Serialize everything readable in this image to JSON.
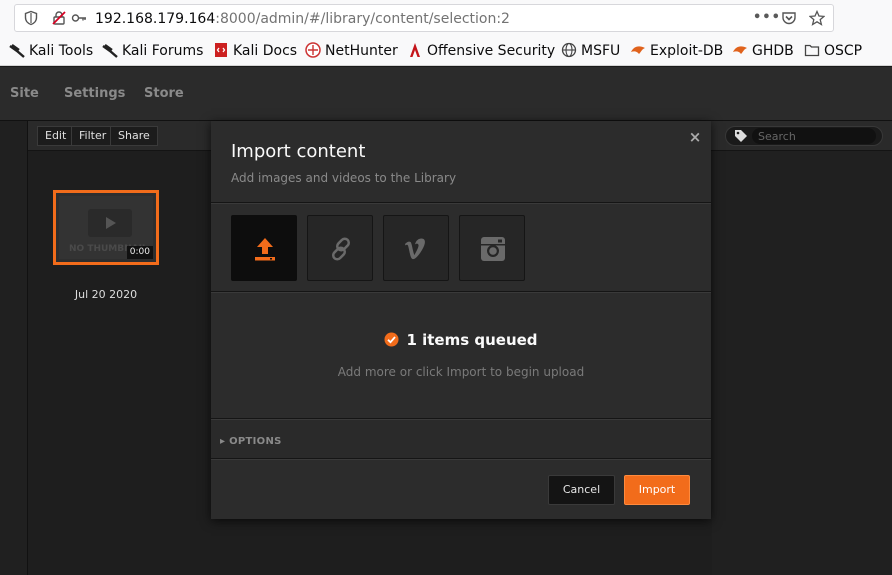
{
  "browser": {
    "url_host": "192.168.179.164",
    "url_rest": ":8000/admin/#/library/content/selection:2",
    "bookmarks": [
      {
        "label": "Kali Tools"
      },
      {
        "label": "Kali Forums"
      },
      {
        "label": "Kali Docs"
      },
      {
        "label": "NetHunter"
      },
      {
        "label": "Offensive Security"
      },
      {
        "label": "MSFU"
      },
      {
        "label": "Exploit-DB"
      },
      {
        "label": "GHDB"
      },
      {
        "label": "OSCP"
      }
    ]
  },
  "app": {
    "nav": {
      "site": "Site",
      "settings": "Settings",
      "store": "Store"
    },
    "toolbar": {
      "edit": "Edit",
      "filter": "Filter",
      "share": "Share"
    },
    "search": {
      "placeholder": "Search"
    },
    "media": {
      "thumb_label": "NO THUMBNAIL",
      "duration": "0:00",
      "date": "Jul 20 2020"
    }
  },
  "modal": {
    "title": "Import content",
    "subtitle": "Add images and videos to the Library",
    "sources": [
      {
        "name": "upload",
        "icon": "upload-icon"
      },
      {
        "name": "link",
        "icon": "link-icon"
      },
      {
        "name": "vimeo",
        "icon": "vimeo-icon"
      },
      {
        "name": "instagram",
        "icon": "instagram-icon"
      }
    ],
    "queued": "1 items queued",
    "hint": "Add more or click Import to begin upload",
    "options": "OPTIONS",
    "cancel": "Cancel",
    "import": "Import"
  },
  "colors": {
    "accent": "#f26c1b",
    "background": "#1e1e1e",
    "modal": "#2c2c2c"
  }
}
